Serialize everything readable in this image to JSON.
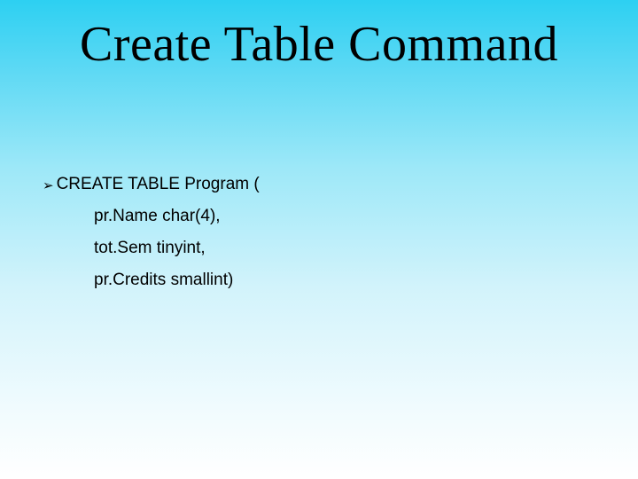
{
  "title": "Create Table Command",
  "bullet_glyph": "➢",
  "sql": {
    "line1": "CREATE TABLE Program (",
    "line2": "pr.Name char(4),",
    "line3": "tot.Sem tinyint,",
    "line4": "pr.Credits smallint)"
  }
}
